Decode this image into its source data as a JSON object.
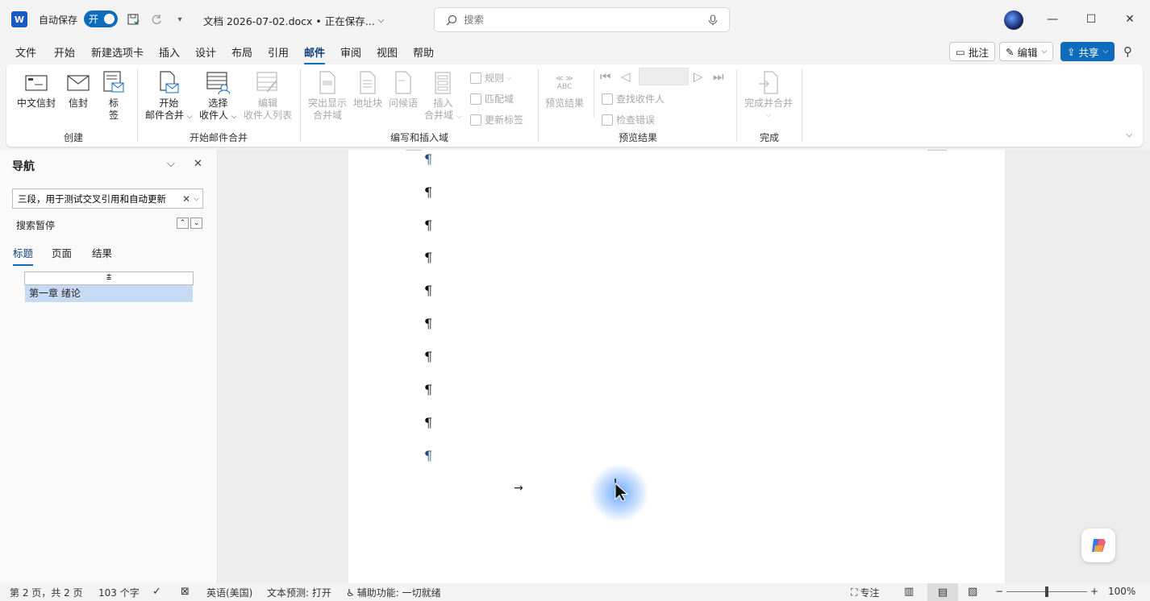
{
  "titlebar": {
    "app_logo": "W",
    "autosave_label": "自动保存",
    "autosave_state": "开",
    "doc_title": "文档 2026-07-02.docx • 正在保存...",
    "search_placeholder": "搜索"
  },
  "menu": {
    "tabs": [
      "文件",
      "开始",
      "新建选项卡",
      "插入",
      "设计",
      "布局",
      "引用",
      "邮件",
      "审阅",
      "视图",
      "帮助"
    ],
    "active": "邮件",
    "comments_label": "批注",
    "editing_label": "编辑",
    "share_label": "共享"
  },
  "ribbon": {
    "create": {
      "label": "创建",
      "envelopes": "中文信封",
      "letters": "信封",
      "labels_line1": "标",
      "labels_line2": "签"
    },
    "start_merge": {
      "label": "开始邮件合并",
      "start_line1": "开始",
      "start_line2": "邮件合并",
      "select_line1": "选择",
      "select_line2": "收件人",
      "edit_line1": "编辑",
      "edit_line2": "收件人列表"
    },
    "write_insert": {
      "label": "编写和插入域",
      "highlight_line1": "突出显示",
      "highlight_line2": "合并域",
      "address_block": "地址块",
      "greeting": "问候语",
      "insert_line1": "插入",
      "insert_line2": "合并域",
      "rules": "规则",
      "match_fields": "匹配域",
      "update_labels": "更新标签"
    },
    "preview": {
      "label": "预览结果",
      "preview_results": "预览结果",
      "abc": "ABC",
      "find_recipient": "查找收件人",
      "check_errors": "检查错误"
    },
    "finish": {
      "label": "完成",
      "finish_merge": "完成并合并"
    }
  },
  "nav": {
    "title": "导航",
    "search_value": "三段，用于测试交叉引用和自动更新",
    "status": "搜索暂停",
    "tabs": [
      "标题",
      "页面",
      "结果"
    ],
    "heading_item": "第一章 绪论"
  },
  "statusbar": {
    "page": "第 2 页，共 2 页",
    "words": "103 个字",
    "language": "英语(美国)",
    "text_prediction": "文本预测: 打开",
    "accessibility": "辅助功能: 一切就绪",
    "focus": "专注",
    "zoom": "100%",
    "zoom_level": 0.5
  },
  "document": {
    "pilcrow": "¶",
    "tab_arrow": "→"
  },
  "colors": {
    "accent": "#0f6cbd",
    "nav_highlight": "#c7daf4"
  }
}
